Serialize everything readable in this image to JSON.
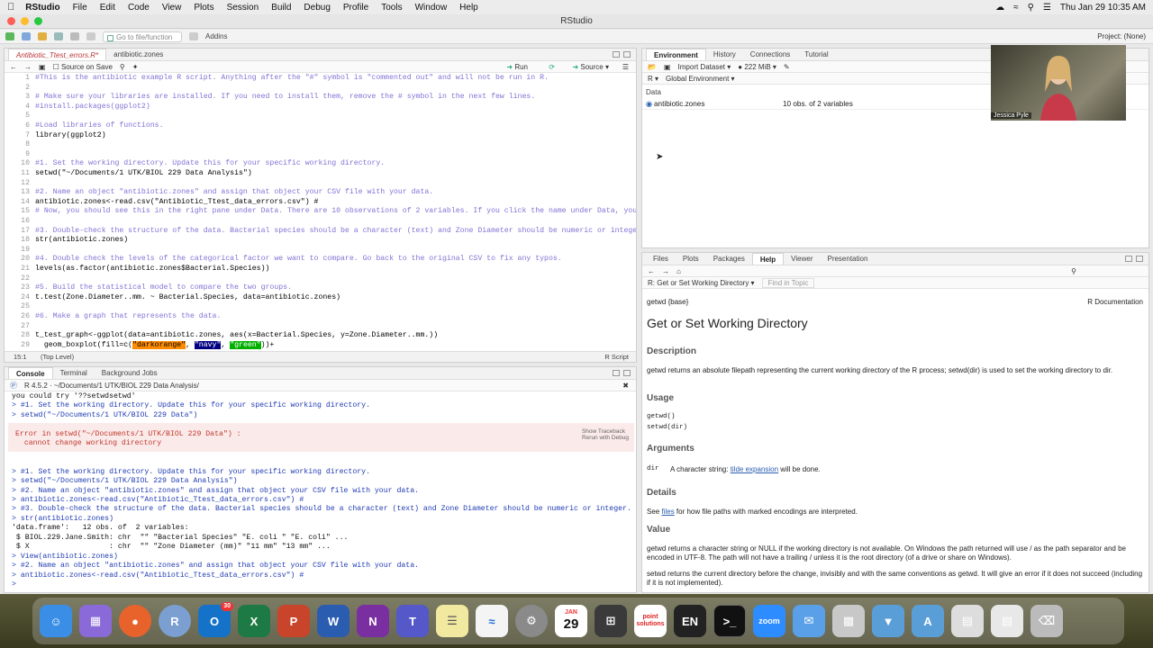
{
  "menubar": {
    "app": "RStudio",
    "items": [
      "File",
      "Edit",
      "Code",
      "View",
      "Plots",
      "Session",
      "Build",
      "Debug",
      "Profile",
      "Tools",
      "Window",
      "Help"
    ],
    "datetime": "Thu Jan 29  10:35 AM"
  },
  "window": {
    "title": "RStudio"
  },
  "toolbar": {
    "goto_placeholder": "Go to file/function",
    "addins": "Addins",
    "project": "Project: (None)"
  },
  "editor": {
    "tabs": [
      "Antibiotic_Ttest_errors.R*",
      "antibiotic.zones"
    ],
    "source_on_save": "Source on Save",
    "run": "Run",
    "source": "Source",
    "lines": [
      "#This is the antibiotic example R script. Anything after the \"#\" symbol is \"commented out\" and will not be run in R.",
      "",
      "# Make sure your libraries are installed. If you need to install them, remove the # symbol in the next few lines.",
      "#install.packages(ggplot2)",
      "",
      "#Load libraries of functions.",
      "library(ggplot2)",
      "",
      "",
      "#1. Set the working directory. Update this for your specific working directory.",
      "setwd(\"~/Documents/1 UTK/BIOL 229 Data Analysis\")",
      "",
      "#2. Name an object \"antibiotic.zones\" and assign that object your CSV file with your data.",
      "antibiotic.zones<-read.csv(\"Antibiotic_Ttest_data_errors.csv\") #",
      "# Now, you should see this in the right pane under Data. There are 10 observations of 2 variables. If you click the name under Data, you can view the",
      "",
      "#3. Double-check the structure of the data. Bacterial species should be a character (text) and Zone Diameter should be numeric or integer.",
      "str(antibiotic.zones)",
      "",
      "#4. Double check the levels of the categorical factor we want to compare. Go back to the original CSV to fix any typos.",
      "levels(as.factor(antibiotic.zones$Bacterial.Species))",
      "",
      "#5. Build the statistical model to compare the two groups.",
      "t.test(Zone.Diameter..mm. ~ Bacterial.Species, data=antibiotic.zones)",
      "",
      "#6. Make a graph that represents the data.",
      "",
      "t_test_graph<-ggplot(data=antibiotic.zones, aes(x=Bacterial.Species, y=Zone.Diameter..mm.))",
      "  geom_boxplot(fill=c("
    ],
    "line29_tokens": [
      "\"darkorange\"",
      "\"navy\"",
      "\"green\"",
      "))+"
    ],
    "status_pos": "15:1",
    "status_level": "(Top Level)",
    "status_type": "R Script"
  },
  "console": {
    "tabs": [
      "Console",
      "Terminal",
      "Background Jobs"
    ],
    "path": "R 4.5.2 · ~/Documents/1 UTK/BIOL 229 Data Analysis/",
    "lines": [
      {
        "t": "out",
        "s": "you could try '??setwdsetwd'"
      },
      {
        "t": "cmd",
        "s": "> #1. Set the working directory. Update this for your specific working directory."
      },
      {
        "t": "cmd",
        "s": "> setwd(\"~/Documents/1 UTK/BIOL 229 Data\")"
      },
      {
        "t": "out",
        "s": ""
      },
      {
        "t": "err",
        "s": "Error in setwd(\"~/Documents/1 UTK/BIOL 229 Data\") :"
      },
      {
        "t": "err",
        "s": "  cannot change working directory"
      },
      {
        "t": "out",
        "s": ""
      },
      {
        "t": "out",
        "s": ""
      },
      {
        "t": "cmd",
        "s": "> #1. Set the working directory. Update this for your specific working directory."
      },
      {
        "t": "cmd",
        "s": "> setwd(\"~/Documents/1 UTK/BIOL 229 Data Analysis\")"
      },
      {
        "t": "cmd",
        "s": "> #2. Name an object \"antibiotic.zones\" and assign that object your CSV file with your data."
      },
      {
        "t": "cmd",
        "s": "> antibiotic.zones<-read.csv(\"Antibiotic_Ttest_data_errors.csv\") #"
      },
      {
        "t": "cmd",
        "s": "> #3. Double-check the structure of the data. Bacterial species should be a character (text) and Zone Diameter should be numeric or integer."
      },
      {
        "t": "cmd",
        "s": "> str(antibiotic.zones)"
      },
      {
        "t": "out",
        "s": "'data.frame':   12 obs. of  2 variables:"
      },
      {
        "t": "out",
        "s": " $ BIOL.229.Jane.Smith: chr  \"\" \"Bacterial Species\" \"E. coli \" \"E. coli\" ..."
      },
      {
        "t": "out",
        "s": " $ X                  : chr  \"\" \"Zone Diameter (mm)\" \"11 mm\" \"13 mm\" ..."
      },
      {
        "t": "cmd",
        "s": "> View(antibiotic.zones)"
      },
      {
        "t": "cmd",
        "s": "> #2. Name an object \"antibiotic.zones\" and assign that object your CSV file with your data."
      },
      {
        "t": "cmd",
        "s": "> antibiotic.zones<-read.csv(\"Antibiotic_Ttest_data_errors.csv\") #"
      },
      {
        "t": "cmd",
        "s": "> "
      }
    ],
    "traceback": "Show Traceback",
    "rerun": "Rerun with Debug"
  },
  "environment": {
    "tabs": [
      "Environment",
      "History",
      "Connections",
      "Tutorial"
    ],
    "import": "Import Dataset",
    "memory": "222 MiB",
    "lang": "R",
    "scope": "Global Environment",
    "section": "Data",
    "var_name": "antibiotic.zones",
    "var_value": "10 obs. of 2 variables"
  },
  "webcam": {
    "name": "Jessica Pyle"
  },
  "help": {
    "tabs": [
      "Files",
      "Plots",
      "Packages",
      "Help",
      "Viewer",
      "Presentation"
    ],
    "topic": "R: Get or Set Working Directory",
    "find": "Find in Topic",
    "pkg": "getwd {base}",
    "rdoc": "R Documentation",
    "title": "Get or Set Working Directory",
    "description_h": "Description",
    "description": "getwd returns an absolute filepath representing the current working directory of the R process; setwd(dir) is used to set the working directory to dir.",
    "usage_h": "Usage",
    "usage1": "getwd()",
    "usage2": "setwd(dir)",
    "arguments_h": "Arguments",
    "arg_name": "dir",
    "arg_desc_pre": "A character string: ",
    "arg_link": "tilde expansion",
    "arg_desc_post": " will be done.",
    "details_h": "Details",
    "details_pre": "See ",
    "details_link": "files",
    "details_post": " for how file paths with marked encodings are interpreted.",
    "value_h": "Value",
    "value1": "getwd returns a character string or NULL if the working directory is not available. On Windows the path returned will use / as the path separator and be encoded in UTF-8. The path will not have a trailing / unless it is the root directory (of a drive or share on Windows).",
    "value2": "setwd returns the current directory before the change, invisibly and with the same conventions as getwd. It will give an error if it does not succeed (including if it is not implemented)."
  },
  "dock": {
    "calendar_month": "JAN",
    "calendar_day": "29",
    "outlook_badge": "30",
    "point_label": "point solutions",
    "keyboard_label": "EN",
    "zoom_label": "zoom"
  },
  "colors": {
    "comment": "#6a5acd",
    "command": "#1f3bb3",
    "error": "#c0392b",
    "link": "#2a5db0"
  }
}
